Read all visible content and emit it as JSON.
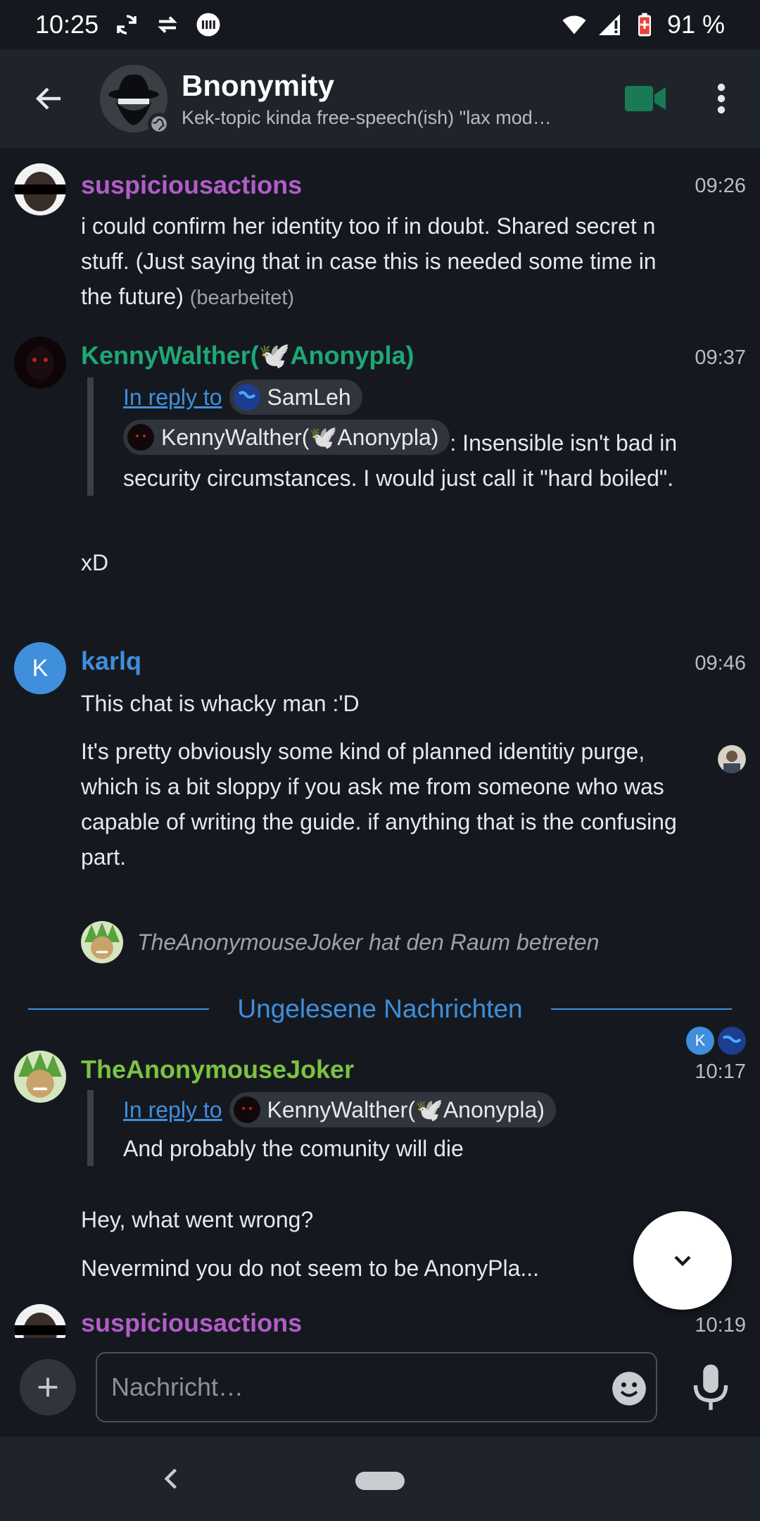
{
  "status_bar": {
    "time": "10:25",
    "battery": "91 %"
  },
  "header": {
    "title": "Bnonymity",
    "topic": "Kek-topic kinda free-speech(ish) \"lax mod…"
  },
  "messages": [
    {
      "sender": "suspiciousactions",
      "sender_color": "#b35cc8",
      "time": "09:26",
      "body": "i could confirm her identity too if in doubt. Shared secret n stuff. (Just saying that in case this is needed some time in the future)",
      "edited": "(bearbeitet)"
    },
    {
      "sender": "KennyWalther(🕊️Anonypla)",
      "sender_color": "#1fa774",
      "time": "09:37",
      "reply_label": "In reply to",
      "reply_to": "SamLeh",
      "quoted_pill": "KennyWalther(🕊️Anonypla)",
      "quoted_text": ": Insensible isn't bad in security circumstances. I would just call it \"hard boiled\".",
      "body": "xD"
    },
    {
      "sender": "karlq",
      "sender_color": "#3f8fdc",
      "avatar_letter": "K",
      "time": "09:46",
      "body_1": "This chat is whacky man :'D",
      "body_2": "It's pretty obviously some kind of planned identitiy purge, which is a bit sloppy if you ask me from someone who was capable of writing the guide. if anything that is the confusing part.",
      "read_receipt_letter": "K"
    },
    {
      "state_event": "TheAnonymouseJoker hat den Raum betreten"
    },
    {
      "sender": "TheAnonymouseJoker",
      "sender_color": "#7cc243",
      "time": "10:17",
      "reply_label": "In reply to",
      "reply_to": "KennyWalther(🕊️Anonypla)",
      "quoted_text": "And probably the comunity will die",
      "body_1": "Hey, what went wrong?",
      "body_2": "Nevermind you do not seem to be AnonyPla..."
    },
    {
      "sender": "suspiciousactions",
      "sender_color": "#b35cc8",
      "time": "10:19"
    }
  ],
  "unread_divider": "Ungelesene Nachrichten",
  "composer": {
    "placeholder": "Nachricht…"
  },
  "colors": {
    "accent": "#3f8fdc",
    "background": "#15191f",
    "appbar": "#1f242b",
    "video_icon": "#1a7a55"
  }
}
